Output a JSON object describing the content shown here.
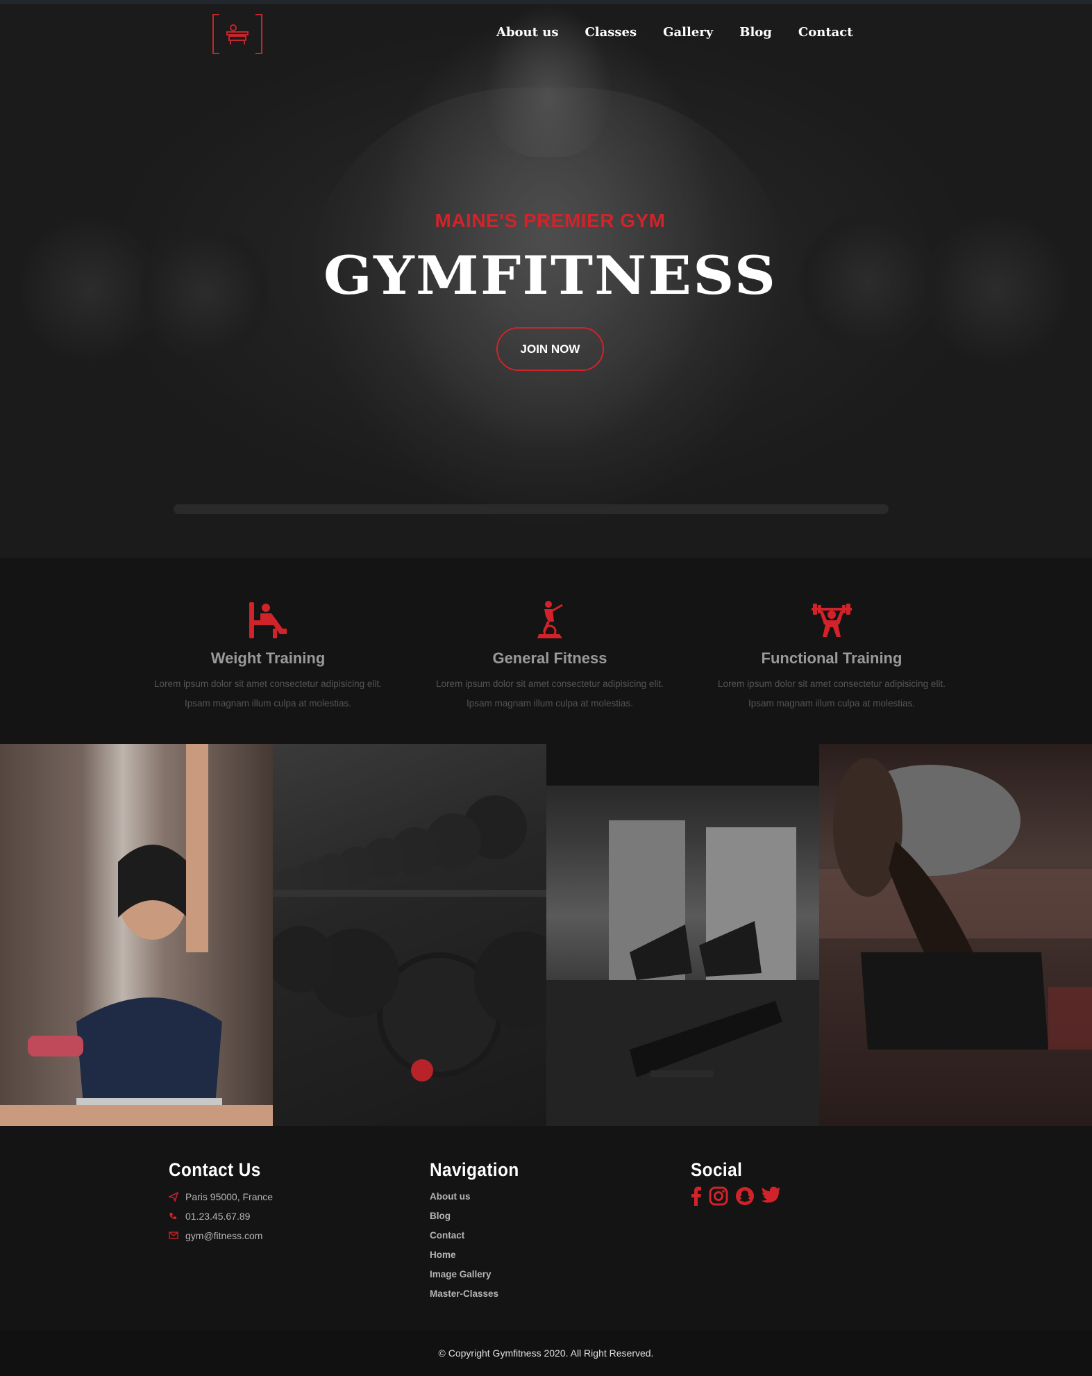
{
  "nav": {
    "logo_icon": "bench-press-logo-icon",
    "items": [
      {
        "label": "About us"
      },
      {
        "label": "Classes"
      },
      {
        "label": "Gallery"
      },
      {
        "label": "Blog"
      },
      {
        "label": "Contact"
      }
    ]
  },
  "hero": {
    "tagline": "MAINE'S PREMIER GYM",
    "title": "GYMFITNESS",
    "cta_label": "JOIN NOW"
  },
  "features": [
    {
      "icon": "weight-training-icon",
      "title": "Weight Training",
      "line1": "Lorem ipsum dolor sit amet consectetur adipisicing elit.",
      "line2": "Ipsam magnam illum culpa at molestias."
    },
    {
      "icon": "elliptical-trainer-icon",
      "title": "General Fitness",
      "line1": "Lorem ipsum dolor sit amet consectetur adipisicing elit.",
      "line2": "Ipsam magnam illum culpa at molestias."
    },
    {
      "icon": "weightlifter-icon",
      "title": "Functional Training",
      "line1": "Lorem ipsum dolor sit amet consectetur adipisicing elit.",
      "line2": "Ipsam magnam illum culpa at molestias."
    }
  ],
  "gallery": [
    {
      "name": "woman-dumbbell-photo"
    },
    {
      "name": "dumbbell-rack-photo"
    },
    {
      "name": "gym-interior-photo"
    },
    {
      "name": "athlete-stretching-photo"
    }
  ],
  "footer": {
    "contact": {
      "heading": "Contact Us",
      "address": "Paris 95000, France",
      "phone": "01.23.45.67.89",
      "email": "gym@fitness.com"
    },
    "navigation": {
      "heading": "Navigation",
      "links": [
        "About us",
        "Blog",
        "Contact",
        "Home",
        "Image Gallery",
        "Master-Classes"
      ]
    },
    "social": {
      "heading": "Social",
      "icons": [
        "facebook-icon",
        "instagram-icon",
        "snapchat-icon",
        "twitter-icon"
      ]
    },
    "copyright": "© Copyright Gymfitness 2020. All Right Reserved."
  },
  "colors": {
    "accent": "#d1232a",
    "background": "#141414",
    "footer_bottom": "#111111",
    "muted_text": "#9a9a9a"
  }
}
